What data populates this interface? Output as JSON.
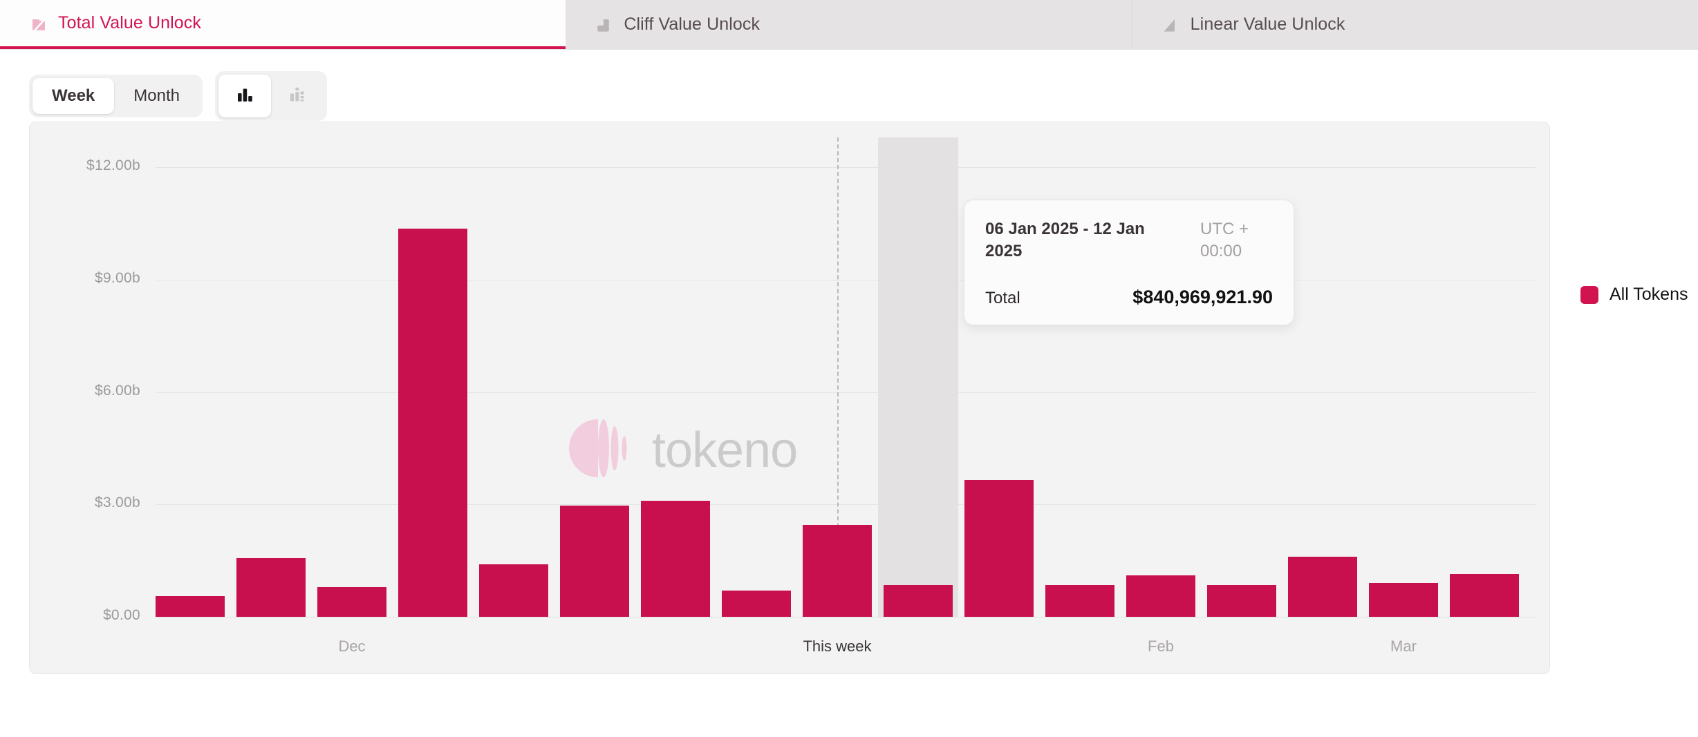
{
  "tabs": [
    {
      "label": "Total Value Unlock",
      "icon": "total-value-unlock-icon",
      "active": true
    },
    {
      "label": "Cliff Value Unlock",
      "icon": "cliff-value-unlock-icon",
      "active": false
    },
    {
      "label": "Linear Value Unlock",
      "icon": "linear-value-unlock-icon",
      "active": false
    }
  ],
  "controls": {
    "period": {
      "options": [
        "Week",
        "Month"
      ],
      "selected": "Week"
    },
    "chart_type": {
      "options": [
        "bar-chart-icon",
        "stacked-bar-chart-icon"
      ],
      "selected": "bar-chart-icon"
    }
  },
  "legend": {
    "items": [
      {
        "label": "All Tokens",
        "color": "#d11450"
      }
    ]
  },
  "watermark": {
    "text": "tokeno",
    "logo": "tokenomist-logo-icon"
  },
  "tooltip": {
    "date_range": "06 Jan 2025 - 12 Jan 2025",
    "timezone": "UTC + 00:00",
    "total_label": "Total",
    "total_value": "$840,969,921.90"
  },
  "chart_data": {
    "type": "bar",
    "title": "Total Value Unlock",
    "xlabel": "",
    "ylabel": "",
    "ylim": [
      0,
      12
    ],
    "grid": true,
    "legend_position": "right",
    "y_ticks": [
      "$0.00",
      "$3.00b",
      "$6.00b",
      "$9.00b",
      "$12.00b"
    ],
    "y_tick_values": [
      0,
      3,
      6,
      9,
      12
    ],
    "x_ticks": [
      {
        "label": "Dec",
        "index": 2,
        "current": false
      },
      {
        "label": "This week",
        "index": 8,
        "current": true
      },
      {
        "label": "Feb",
        "index": 12,
        "current": false
      },
      {
        "label": "Mar",
        "index": 15,
        "current": false
      }
    ],
    "series": [
      {
        "name": "All Tokens",
        "color": "#c8104f",
        "values": [
          0.55,
          1.56,
          0.8,
          10.36,
          1.4,
          2.97,
          3.1,
          0.7,
          2.45,
          0.84,
          3.65,
          0.85,
          1.1,
          0.85,
          1.6,
          0.9,
          1.15
        ]
      }
    ],
    "highlight": {
      "index": 9,
      "value": 0.84,
      "label": "06 Jan 2025 - 12 Jan 2025"
    },
    "now_marker": {
      "index": 8,
      "label": "This week"
    }
  }
}
